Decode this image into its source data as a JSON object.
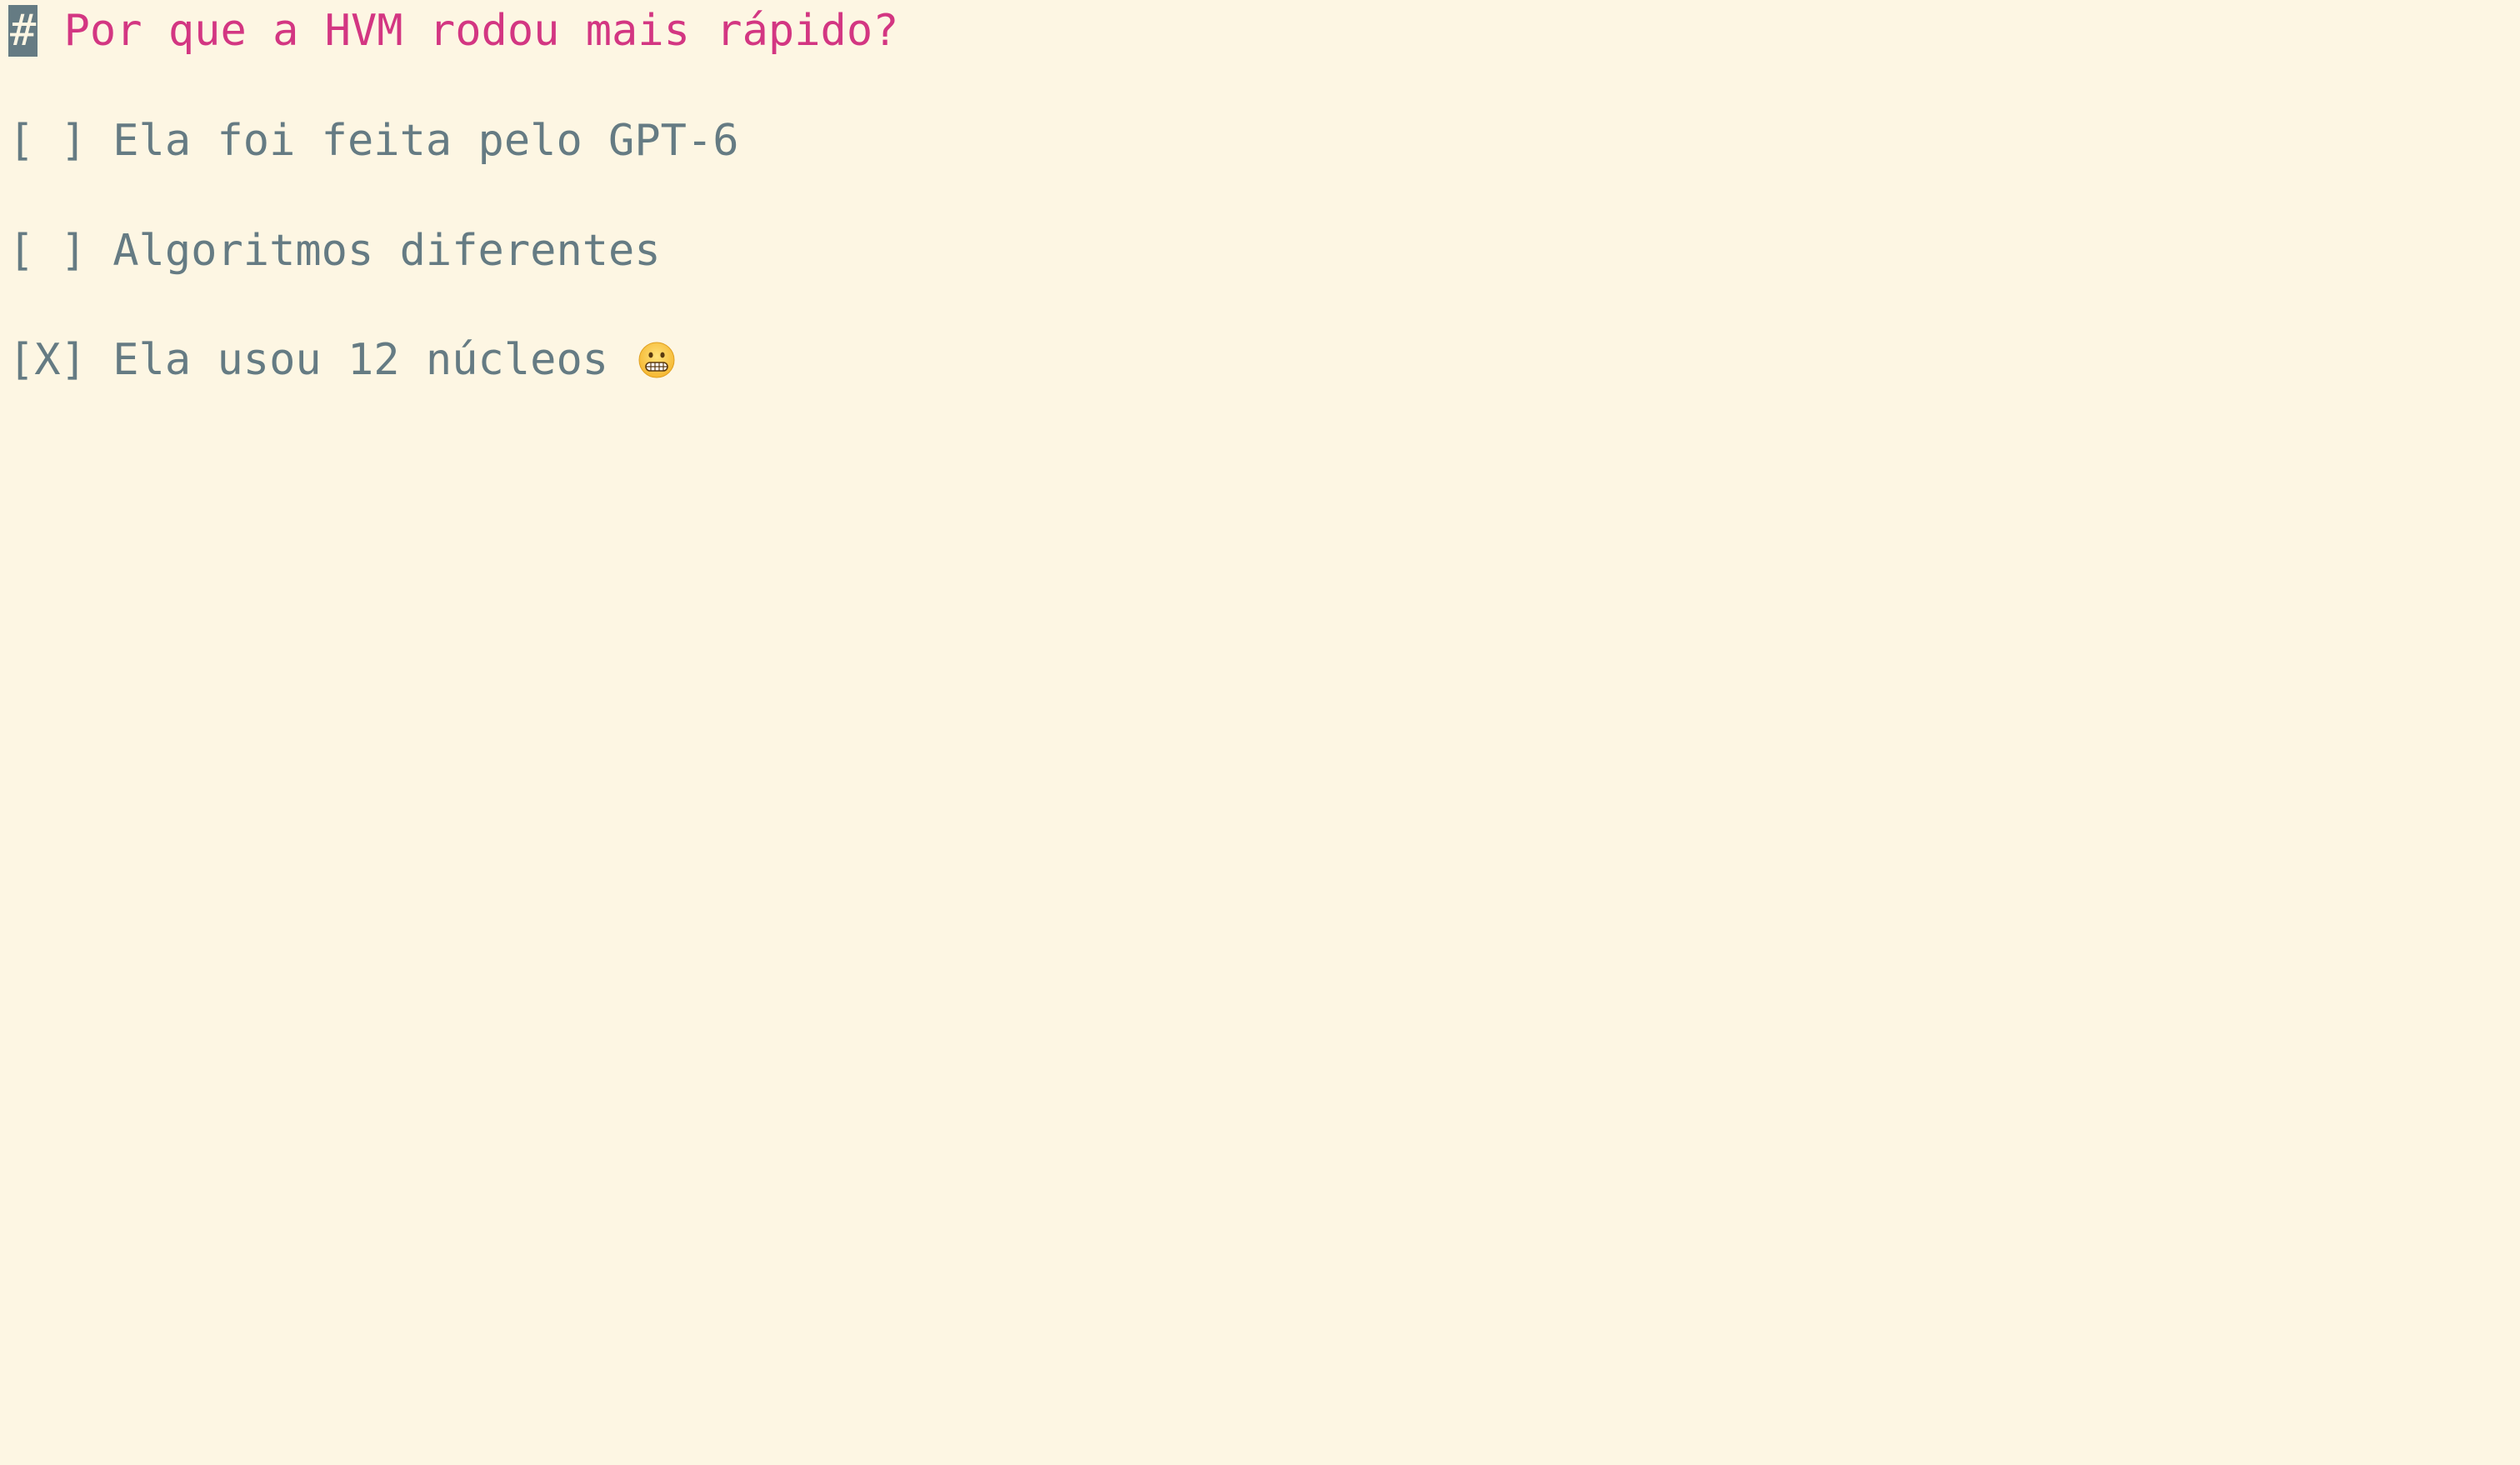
{
  "colors": {
    "background": "#fdf6e3",
    "text": "#657b83",
    "heading": "#d33682",
    "cursor": "#657b83"
  },
  "document": {
    "heading_marker": "#",
    "heading_text": " Por que a HVM rodou mais rápido?",
    "options": [
      {
        "checkbox": "[ ]",
        "text": " Ela foi feita pelo GPT-6"
      },
      {
        "checkbox": "[ ]",
        "text": " Algoritmos diferentes"
      },
      {
        "checkbox": "[X]",
        "text": " Ela usou 12 núcleos ",
        "icon": "grimacing-face-emoji"
      }
    ]
  }
}
